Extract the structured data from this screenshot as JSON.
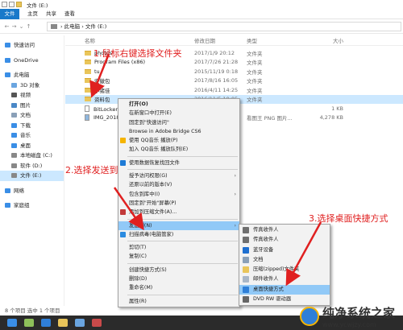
{
  "window": {
    "title": "文件 (E:)"
  },
  "ribbon": {
    "tabs": [
      "文件",
      "主页",
      "共享",
      "查看"
    ]
  },
  "address": {
    "path": "› 此电脑 › 文件 (E:)"
  },
  "sidebar": {
    "items": [
      {
        "label": "快速访问",
        "color": "#3a8ee6"
      },
      {
        "label": "OneDrive",
        "color": "#3a8ee6"
      },
      {
        "label": "此电脑",
        "color": "#3a8ee6"
      },
      {
        "label": "3D 对象",
        "color": "#6aa5e0"
      },
      {
        "label": "视频",
        "color": "#555"
      },
      {
        "label": "图片",
        "color": "#4a88c7"
      },
      {
        "label": "文档",
        "color": "#8aa0b8"
      },
      {
        "label": "下载",
        "color": "#3a8ee6"
      },
      {
        "label": "音乐",
        "color": "#3a8ee6"
      },
      {
        "label": "桌面",
        "color": "#3a8ee6"
      },
      {
        "label": "本地磁盘 (C:)",
        "color": "#888"
      },
      {
        "label": "软件 (D:)",
        "color": "#888"
      },
      {
        "label": "文件 (E:)",
        "color": "#888"
      },
      {
        "label": "网络",
        "color": "#3a8ee6"
      },
      {
        "label": "家庭组",
        "color": "#3a8ee6"
      }
    ]
  },
  "filelist": {
    "headers": {
      "name": "名称",
      "date": "修改日期",
      "type": "类型",
      "size": "大小"
    },
    "rows": [
      {
        "name": "photos",
        "date": "2017/1/9 20:12",
        "type": "文件夹",
        "size": "",
        "kind": "folder"
      },
      {
        "name": "Program Files (x86)",
        "date": "2017/7/26 21:28",
        "type": "文件夹",
        "size": "",
        "kind": "folder"
      },
      {
        "name": "tu",
        "date": "2015/11/19 0:18",
        "type": "文件夹",
        "size": "",
        "kind": "folder"
      },
      {
        "name": "安徽包",
        "date": "2017/8/16 16:05",
        "type": "文件夹",
        "size": "",
        "kind": "folder"
      },
      {
        "name": "小猪佳",
        "date": "2016/4/11 14:25",
        "type": "文件夹",
        "size": "",
        "kind": "folder"
      },
      {
        "name": "资料包",
        "date": "2016/11/5 10:05",
        "type": "文件夹",
        "size": "",
        "kind": "folder"
      },
      {
        "name": "BitLocker 恢",
        "date": "",
        "type": "",
        "size": "1 KB",
        "kind": "file"
      },
      {
        "name": "IMG_201806",
        "date": "",
        "type": "看图王 PNG 图片...",
        "size": "4,278 KB",
        "kind": "file"
      }
    ]
  },
  "status": {
    "text": "8 个项目    选中 1 个项目"
  },
  "context_menu": {
    "items": [
      {
        "label": "打开(O)",
        "bold": true
      },
      {
        "label": "在新窗口中打开(E)"
      },
      {
        "label": "固定到\"快速访问\""
      },
      {
        "label": "Browse in Adobe Bridge CS6"
      },
      {
        "label": "使用 QQ音乐 播放(P)",
        "icon": "#f5b400"
      },
      {
        "label": "加入 QQ音乐 播放队列(E)"
      },
      {
        "sep": true
      },
      {
        "label": "使用数据恢复找回文件",
        "icon": "#1e7bd6"
      },
      {
        "sep": true
      },
      {
        "label": "授予访问权限(G)",
        "sub": true
      },
      {
        "label": "还原以前的版本(V)"
      },
      {
        "label": "包含到库中(I)",
        "sub": true
      },
      {
        "label": "固定到\"开始\"屏幕(P)"
      },
      {
        "label": "添加到压缩文件(A)...",
        "icon": "#c23a3a"
      },
      {
        "sep": true
      },
      {
        "label": "发送到(N)",
        "sub": true,
        "hl": true
      },
      {
        "label": "扫描病毒(电脑管家)",
        "icon": "#2b8be0"
      },
      {
        "sep": true
      },
      {
        "label": "剪切(T)"
      },
      {
        "label": "复制(C)"
      },
      {
        "sep": true
      },
      {
        "label": "创建快捷方式(S)"
      },
      {
        "label": "删除(D)"
      },
      {
        "label": "重命名(M)"
      },
      {
        "sep": true
      },
      {
        "label": "属性(R)"
      }
    ]
  },
  "sendto_menu": {
    "items": [
      {
        "label": "传真收件人",
        "icon": "#6f6f6f"
      },
      {
        "label": "传真收件人",
        "icon": "#6f6f6f"
      },
      {
        "label": "蓝牙设备",
        "icon": "#1e6fd0"
      },
      {
        "label": "文档",
        "icon": "#8aa0b8"
      },
      {
        "label": "压缩(zipped)文件夹",
        "icon": "#e9c55a"
      },
      {
        "label": "邮件收件人",
        "icon": "#a9b7c7"
      },
      {
        "label": "桌面快捷方式",
        "icon": "#2f7fd8",
        "hl": true
      },
      {
        "label": "DVD RW 驱动器",
        "icon": "#666"
      }
    ]
  },
  "annotations": {
    "step1": "1.鼠标右键选择文件夹",
    "step2": "2.选择发送到",
    "step3": "3.选择桌面快捷方式"
  },
  "watermark": {
    "title": "纯净系统之家",
    "url": "www.ycwjzy.com"
  },
  "colors": {
    "accent": "#1979ca",
    "selection": "#cce8ff",
    "highlight": "#91c9f7",
    "annotation": "#e02020"
  }
}
